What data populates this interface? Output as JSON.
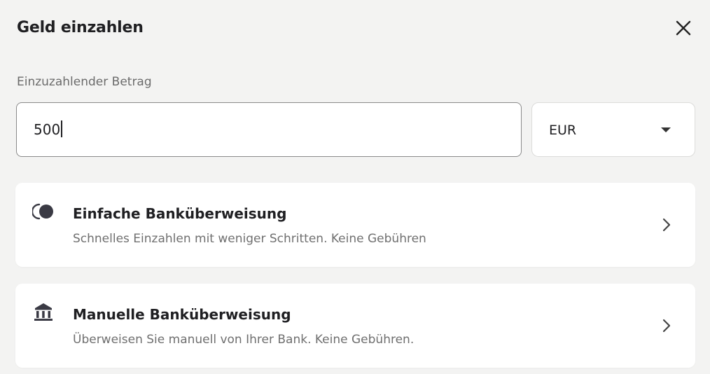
{
  "dialog": {
    "title": "Geld einzahlen",
    "close_icon": "close-icon"
  },
  "amount": {
    "label": "Einzuzahlender Betrag",
    "value": "500",
    "currency": "EUR",
    "currency_icon": "chevron-down-icon"
  },
  "options": [
    {
      "title": "Einfache Banküberweisung",
      "description": "Schnelles Einzahlen mit weniger Schritten. Keine Gebühren",
      "icon": "instant-transfer-icon",
      "arrow_icon": "chevron-right-icon"
    },
    {
      "title": "Manuelle Banküberweisung",
      "description": "Überweisen Sie manuell von Ihrer Bank. Keine Gebühren.",
      "icon": "bank-icon",
      "arrow_icon": "chevron-right-icon"
    }
  ],
  "colors": {
    "background": "#f3f3f2",
    "card": "#ffffff",
    "text_primary": "#1f1f22",
    "text_secondary": "#6f6f6f",
    "input_border": "#8a8a8a"
  }
}
